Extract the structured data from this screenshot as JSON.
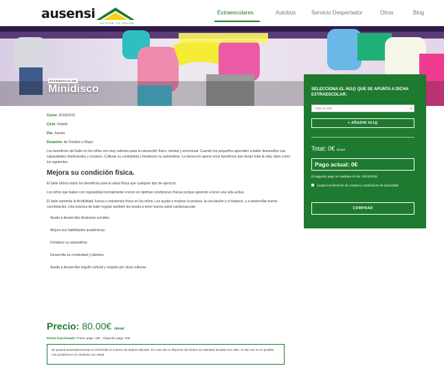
{
  "header": {
    "logo_text": "ausensi",
    "logo_tagline": "ACTIVA TU SALUD",
    "nav": [
      "Extraescolares",
      "Autobús",
      "Servicio Despertador",
      "Otros",
      "Blog"
    ]
  },
  "hero": {
    "label": "EXTRAESCOLAR",
    "title": "Minidisco"
  },
  "details": {
    "curso_key": "Curso:",
    "curso_val": "2018/2019",
    "ciclo_key": "Ciclo:",
    "ciclo_val": "Infantil",
    "dia_key": "Día:",
    "dia_val": "Jueves",
    "duracion_key": "Duración:",
    "duracion_val": "de Octubre a Mayo"
  },
  "body": {
    "intro": "Los beneficios del baile en los niños son muy valiosos para su desarrollo físico, mental y emocional. Cuando los pequeños aprenden a bailar desarrollan sus capacidades intelectuales y sociales. Cultivan su creatividad y fortalecen su autoestima. La danza les aporta unos beneficios que duran toda la vida, tales como los siguientes.",
    "heading": "Mejora su condición física.",
    "p1": "El baile ofrece todos los beneficios para la salud física que cualquier tipo de ejercicio.",
    "p2": "Los niños que bailan con regularidad normalmente crecen en óptimas condiciones físicas porque aprende a tener una vida activa.",
    "p3": "El baile aumenta la flexibilidad, fuerza y resistencia física en los niños. Les ayuda a mejorar la postura, la circulación y el balance, y a desarrollar buena coordinación. Una práctica de baile regular también les ayuda a tener buena salud cardiovascular.",
    "bullets": [
      "Ayuda a desarrollar destrezas sociales.",
      "Mejora sus habilidades académicas.",
      "Fortalece su autoestima.",
      "Desarrolla su creatividad y talentos.",
      "Ayuda a desarrollar orgullo cultural y respeto por otras culturas."
    ]
  },
  "price": {
    "label": "Precio:",
    "value": "80.00€",
    "unit": "/anual",
    "split_key": "Precio fraccionado:",
    "split_val": "Primer pago: 40€ - Segundo pago: 40€",
    "notice": "Se pasará automáticamente el 10/X/2108 al número de tarjeta indicado. En caso de no disponer de fondos se intentará durante tres días. Si aún así no es posible, nos pondremos en contacto con usted."
  },
  "panel": {
    "title": "SELECCIONA EL HIJ@ QUE SE APUNTA A DICHA EXTRAESCOLAR:",
    "select_value": "Elija un niño",
    "add_button": "+ AÑADIR HIJ@",
    "total_label": "Total: 0€",
    "total_unit": "/anual",
    "pago_actual": "Pago actual: 0€",
    "second_payment": "El segundo pago se realizara el día: 10/10/2018",
    "terms": "Acepto los términos de compra y condiciones de privacidad",
    "buy_button": "COMPRAR"
  },
  "colors": {
    "brand_green": "#1e7a2e",
    "white": "#ffffff"
  }
}
